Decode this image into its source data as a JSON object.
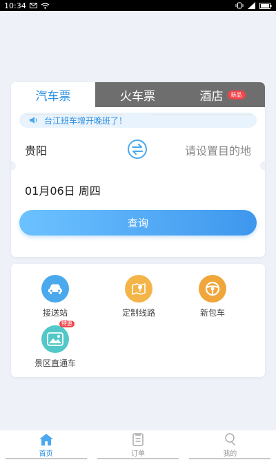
{
  "status_bar": {
    "time": "10:34"
  },
  "tabs": [
    {
      "label": "汽车票",
      "active": true
    },
    {
      "label": "火车票",
      "active": false
    },
    {
      "label": "酒店",
      "badge": "新品",
      "active": false
    }
  ],
  "notice": {
    "text": "台江班车增开晚班了！",
    "icon": "speaker-icon"
  },
  "route": {
    "from": "贵阳",
    "to_placeholder": "请设置目的地",
    "swap_icon": "swap-icon"
  },
  "date": "01月06日 周四",
  "search_button": "查询",
  "services": [
    {
      "label": "接送站",
      "icon": "car-icon",
      "color": "#4aa8ec"
    },
    {
      "label": "定制线路",
      "icon": "map-pin-icon",
      "color": "#f4b448"
    },
    {
      "label": "新包车",
      "icon": "steering-wheel-icon",
      "color": "#f0a63a"
    },
    {
      "label": "景区直通车",
      "icon": "scenery-icon",
      "color": "#53c8c8",
      "badge": "特惠"
    }
  ],
  "bottom_nav": [
    {
      "label": "首页",
      "icon": "home-icon",
      "active": true
    },
    {
      "label": "订单",
      "icon": "order-icon",
      "active": false
    },
    {
      "label": "我的",
      "icon": "profile-icon",
      "active": false
    }
  ],
  "colors": {
    "accent": "#2d8fe0",
    "badge": "#f0454b"
  }
}
